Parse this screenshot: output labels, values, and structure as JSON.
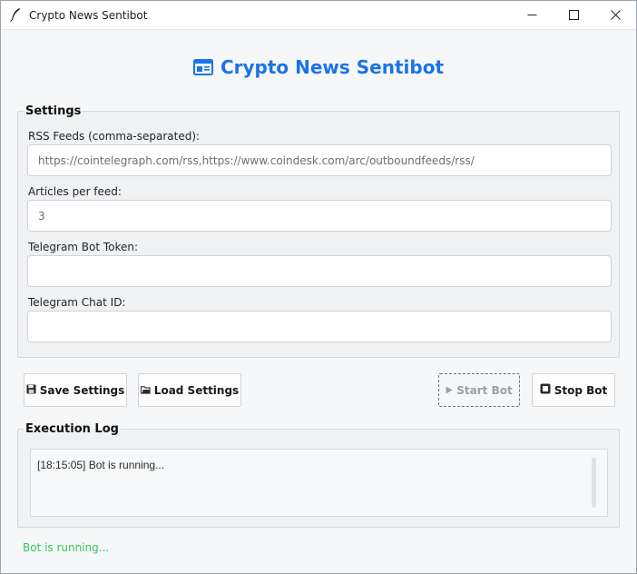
{
  "window": {
    "title": "Crypto News Sentibot",
    "icon": "feather-icon"
  },
  "header": {
    "title": "Crypto News Sentibot",
    "icon": "newspaper-icon",
    "accent_color": "#1a73e8"
  },
  "settings": {
    "legend": "Settings",
    "rss_label": "RSS Feeds (comma-separated):",
    "rss_value": "https://cointelegraph.com/rss,https://www.coindesk.com/arc/outboundfeeds/rss/",
    "articles_label": "Articles per feed:",
    "articles_value": "3",
    "token_label": "Telegram Bot Token:",
    "token_value": "",
    "chat_label": "Telegram Chat ID:",
    "chat_value": ""
  },
  "buttons": {
    "save": "Save Settings",
    "load": "Load Settings",
    "start": "Start Bot",
    "stop": "Stop Bot"
  },
  "log": {
    "legend": "Execution Log",
    "lines": [
      "[18:15:05] Bot is running..."
    ]
  },
  "status": {
    "text": "Bot is running...",
    "color": "#34c759"
  }
}
